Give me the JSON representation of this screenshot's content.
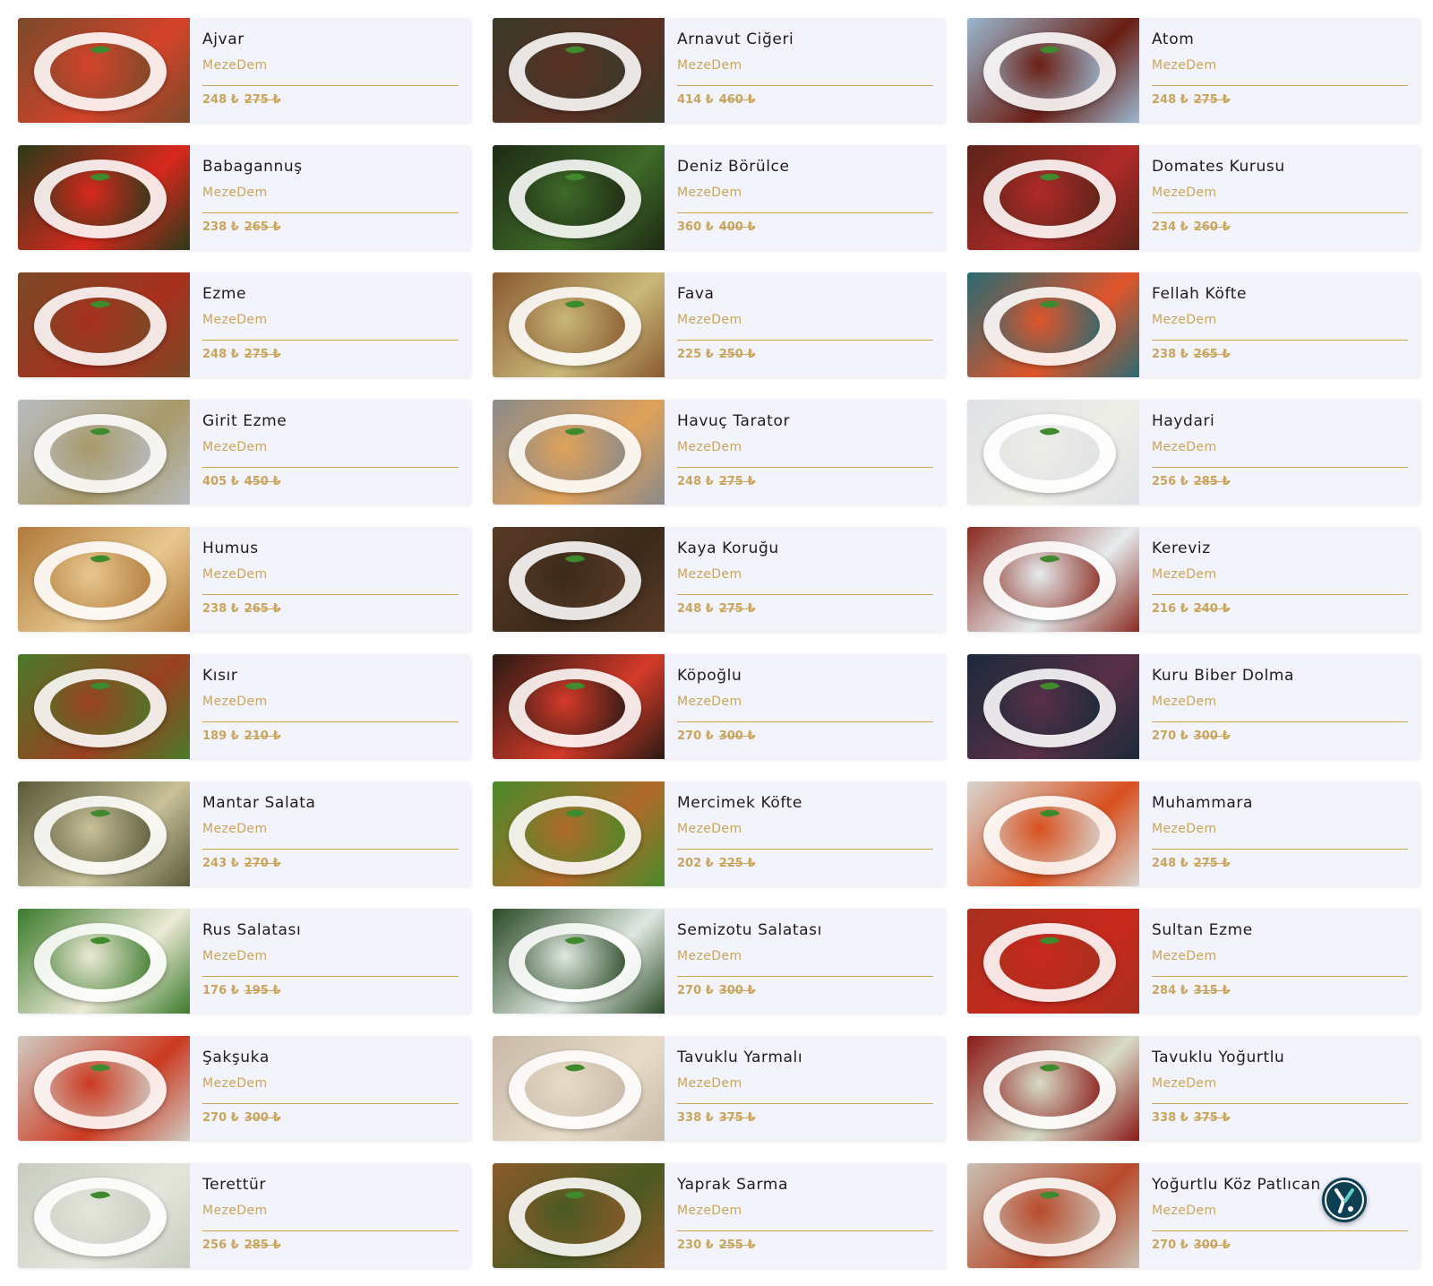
{
  "currency_symbol": "₺",
  "items": [
    {
      "name": "Ajvar",
      "brand": "MezeDem",
      "price": "248 ₺",
      "old_price": "275 ₺",
      "image_colors": [
        "#7a4a2a",
        "#d4432a"
      ]
    },
    {
      "name": "Arnavut Ciğeri",
      "brand": "MezeDem",
      "price": "414 ₺",
      "old_price": "460 ₺",
      "image_colors": [
        "#3a3a2a",
        "#5a3022"
      ]
    },
    {
      "name": "Atom",
      "brand": "MezeDem",
      "price": "248 ₺",
      "old_price": "275 ₺",
      "image_colors": [
        "#9ab8d0",
        "#6a1e12"
      ]
    },
    {
      "name": "Babagannuş",
      "brand": "MezeDem",
      "price": "238 ₺",
      "old_price": "265 ₺",
      "image_colors": [
        "#2a3a1a",
        "#d8281c"
      ]
    },
    {
      "name": "Deniz Börülce",
      "brand": "MezeDem",
      "price": "360 ₺",
      "old_price": "400 ₺",
      "image_colors": [
        "#1e2a14",
        "#3e6a28"
      ]
    },
    {
      "name": "Domates Kurusu",
      "brand": "MezeDem",
      "price": "234 ₺",
      "old_price": "260 ₺",
      "image_colors": [
        "#5a2418",
        "#b02a28"
      ]
    },
    {
      "name": "Ezme",
      "brand": "MezeDem",
      "price": "248 ₺",
      "old_price": "275 ₺",
      "image_colors": [
        "#7a4a26",
        "#a8301e"
      ]
    },
    {
      "name": "Fava",
      "brand": "MezeDem",
      "price": "225 ₺",
      "old_price": "250 ₺",
      "image_colors": [
        "#8a5a30",
        "#c9b878"
      ]
    },
    {
      "name": "Fellah Köfte",
      "brand": "MezeDem",
      "price": "238 ₺",
      "old_price": "265 ₺",
      "image_colors": [
        "#2a6a72",
        "#e0552a"
      ]
    },
    {
      "name": "Girit Ezme",
      "brand": "MezeDem",
      "price": "405 ₺",
      "old_price": "450 ₺",
      "image_colors": [
        "#b8bcc0",
        "#a89a6a"
      ]
    },
    {
      "name": "Havuç Tarator",
      "brand": "MezeDem",
      "price": "248 ₺",
      "old_price": "275 ₺",
      "image_colors": [
        "#8a8a8a",
        "#e0a25a"
      ]
    },
    {
      "name": "Haydari",
      "brand": "MezeDem",
      "price": "256 ₺",
      "old_price": "285 ₺",
      "image_colors": [
        "#dfe2e6",
        "#eeeee6"
      ]
    },
    {
      "name": "Humus",
      "brand": "MezeDem",
      "price": "238 ₺",
      "old_price": "265 ₺",
      "image_colors": [
        "#b07a3a",
        "#e8c890"
      ]
    },
    {
      "name": "Kaya Koruğu",
      "brand": "MezeDem",
      "price": "248 ₺",
      "old_price": "275 ₺",
      "image_colors": [
        "#5a3a26",
        "#3a2a1a"
      ]
    },
    {
      "name": "Kereviz",
      "brand": "MezeDem",
      "price": "216 ₺",
      "old_price": "240 ₺",
      "image_colors": [
        "#8a2a1e",
        "#e6ecee"
      ]
    },
    {
      "name": "Kısır",
      "brand": "MezeDem",
      "price": "189 ₺",
      "old_price": "210 ₺",
      "image_colors": [
        "#4a7a2a",
        "#9a4020"
      ]
    },
    {
      "name": "Köpoğlu",
      "brand": "MezeDem",
      "price": "270 ₺",
      "old_price": "300 ₺",
      "image_colors": [
        "#2a1a14",
        "#d43a28"
      ]
    },
    {
      "name": "Kuru Biber Dolma",
      "brand": "MezeDem",
      "price": "270 ₺",
      "old_price": "300 ₺",
      "image_colors": [
        "#1a2a3a",
        "#5a3048"
      ]
    },
    {
      "name": "Mantar Salata",
      "brand": "MezeDem",
      "price": "243 ₺",
      "old_price": "270 ₺",
      "image_colors": [
        "#5a5a3a",
        "#c8c098"
      ]
    },
    {
      "name": "Mercimek Köfte",
      "brand": "MezeDem",
      "price": "202 ₺",
      "old_price": "225 ₺",
      "image_colors": [
        "#4a8a2a",
        "#b06a2a"
      ]
    },
    {
      "name": "Muhammara",
      "brand": "MezeDem",
      "price": "248 ₺",
      "old_price": "275 ₺",
      "image_colors": [
        "#d8d6d0",
        "#d8501e"
      ]
    },
    {
      "name": "Rus Salatası",
      "brand": "MezeDem",
      "price": "176 ₺",
      "old_price": "195 ₺",
      "image_colors": [
        "#3a7a2a",
        "#ecead6"
      ]
    },
    {
      "name": "Semizotu Salatası",
      "brand": "MezeDem",
      "price": "270 ₺",
      "old_price": "300 ₺",
      "image_colors": [
        "#2a4a26",
        "#dfe8e0"
      ]
    },
    {
      "name": "Sultan Ezme",
      "brand": "MezeDem",
      "price": "284 ₺",
      "old_price": "315 ₺",
      "image_colors": [
        "#a8301e",
        "#c8281c"
      ]
    },
    {
      "name": "Şakşuka",
      "brand": "MezeDem",
      "price": "270 ₺",
      "old_price": "300 ₺",
      "image_colors": [
        "#d0ccc4",
        "#cc3a20"
      ]
    },
    {
      "name": "Tavuklu Yarmalı",
      "brand": "MezeDem",
      "price": "338 ₺",
      "old_price": "375 ₺",
      "image_colors": [
        "#c8b8a8",
        "#e8dcc8"
      ]
    },
    {
      "name": "Tavuklu Yoğurtlu",
      "brand": "MezeDem",
      "price": "338 ₺",
      "old_price": "375 ₺",
      "image_colors": [
        "#8a1a16",
        "#d8dcc8"
      ]
    },
    {
      "name": "Terettür",
      "brand": "MezeDem",
      "price": "256 ₺",
      "old_price": "285 ₺",
      "image_colors": [
        "#c8ccc0",
        "#e4e6dc"
      ]
    },
    {
      "name": "Yaprak Sarma",
      "brand": "MezeDem",
      "price": "230 ₺",
      "old_price": "255 ₺",
      "image_colors": [
        "#8a5a2a",
        "#4a5a22"
      ]
    },
    {
      "name": "Yoğurtlu Köz Patlıcan",
      "brand": "MezeDem",
      "price": "270 ₺",
      "old_price": "300 ₺",
      "image_colors": [
        "#c8c0b4",
        "#b84a2a"
      ]
    }
  ],
  "chat_button": {
    "icon": "chat-logo-icon",
    "color": "#0f3f52"
  }
}
